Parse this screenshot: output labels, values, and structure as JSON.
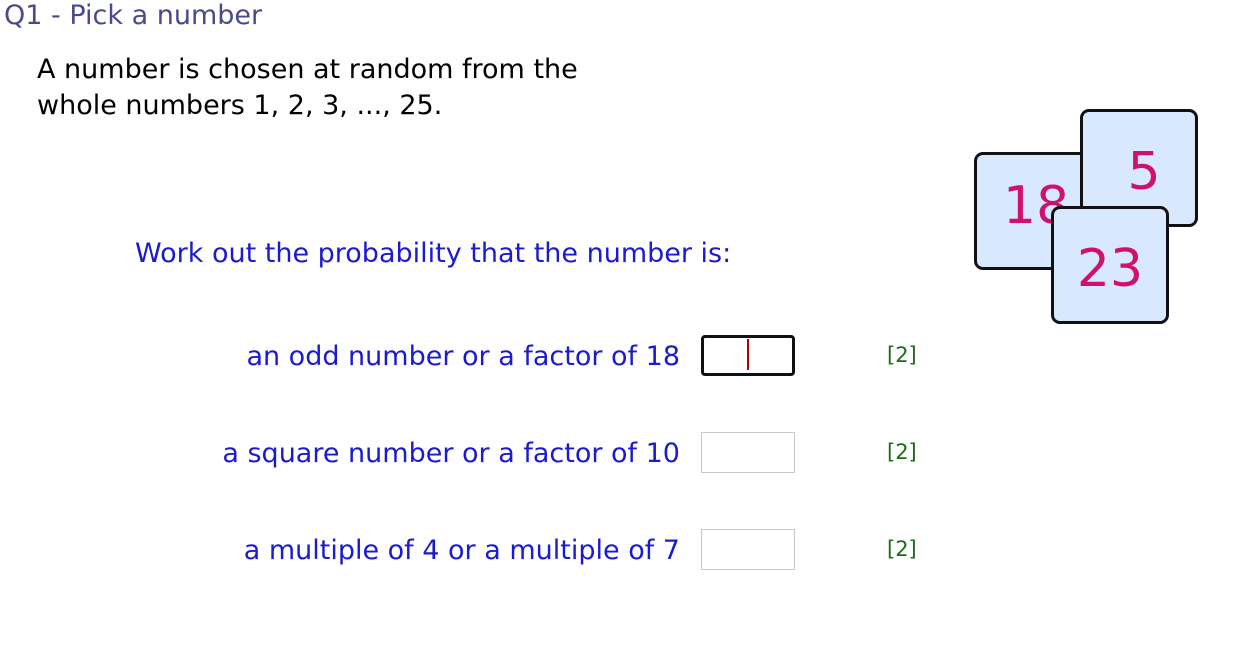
{
  "question": {
    "title": "Q1 - Pick a number",
    "intro_line1": "A number is chosen at random from the",
    "intro_line2": "whole numbers 1, 2, 3, ..., 25.",
    "instruction": "Work out the probability that the number is:"
  },
  "parts": [
    {
      "label": "an odd number or a factor of 18",
      "answer": "",
      "marks": "[2]",
      "focused": true
    },
    {
      "label": "a square number or a factor of 10",
      "answer": "",
      "marks": "[2]",
      "focused": false
    },
    {
      "label": "a multiple of 4 or a multiple of 7",
      "answer": "",
      "marks": "[2]",
      "focused": false
    }
  ],
  "cards": [
    "18",
    "5",
    "23"
  ],
  "colors": {
    "title": "#4a4a8a",
    "question_text": "#1a1ad0",
    "marks": "#1a6e1a",
    "card_fill": "#d8e8ff",
    "card_number": "#d0106e"
  }
}
